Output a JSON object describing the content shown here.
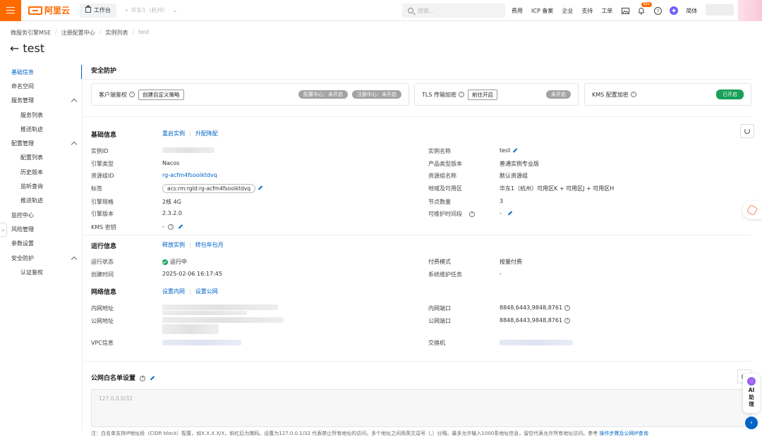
{
  "topbar": {
    "brand": "阿里云",
    "workbench": "工作台",
    "region": "华东1（杭州）",
    "search_placeholder": "搜索...",
    "links": [
      "费用",
      "ICP 备案",
      "企业",
      "支持",
      "工单"
    ],
    "notif_badge": "99+",
    "language": "简体"
  },
  "breadcrumb": [
    "微服务引擎MSE",
    "注册配置中心",
    "实例列表",
    "test"
  ],
  "page_title": "test",
  "sidebar": {
    "items": [
      {
        "label": "基础信息",
        "active": true
      },
      {
        "label": "命名空间"
      },
      {
        "label": "服务管理",
        "expandable": true
      },
      {
        "label": "服务列表",
        "sub": true
      },
      {
        "label": "推送轨迹",
        "sub": true
      },
      {
        "label": "配置管理",
        "expandable": true
      },
      {
        "label": "配置列表",
        "sub": true
      },
      {
        "label": "历史版本",
        "sub": true
      },
      {
        "label": "监听查询",
        "sub": true
      },
      {
        "label": "推送轨迹",
        "sub": true
      },
      {
        "label": "监控中心"
      },
      {
        "label": "风险管理"
      },
      {
        "label": "参数设置"
      },
      {
        "label": "安全防护",
        "expandable": true
      },
      {
        "label": "认证鉴权",
        "sub": true
      }
    ]
  },
  "security": {
    "title": "安全防护",
    "client_auth": "客户端鉴权",
    "create_policy": "创建自定义策略",
    "config_center_status": "配置中心：未开启",
    "registry_center_status": "注册中心：未开启",
    "tls": "TLS 传输加密",
    "tls_goto": "前往开启",
    "tls_status": "未开启",
    "kms": "KMS 配置加密",
    "kms_status": "已开启"
  },
  "basic": {
    "title": "基础信息",
    "restart": "重启实例",
    "upgrade": "升配降配",
    "left": [
      {
        "label": "实例ID",
        "value": ""
      },
      {
        "label": "引擎类型",
        "value": "Nacos"
      },
      {
        "label": "资源组ID",
        "value": "rg-acfm4fsooiktdvq"
      },
      {
        "label": "标签",
        "value": "acs:rm:rgId:rg-acfm4fsooiktdvq"
      },
      {
        "label": "引擎规格",
        "value": "2核 4G"
      },
      {
        "label": "引擎版本",
        "value": "2.3.2.0"
      },
      {
        "label": "KMS 密钥",
        "value": "-"
      }
    ],
    "right": [
      {
        "label": "实例名称",
        "value": "test"
      },
      {
        "label": "产品类型版本",
        "value": "普通实例专业版"
      },
      {
        "label": "资源组名称",
        "value": "默认资源组"
      },
      {
        "label": "地域及可用区",
        "value": "华东1（杭州）可用区K + 可用区J + 可用区H"
      },
      {
        "label": "节点数量",
        "value": "3"
      },
      {
        "label": "可维护时间段",
        "value": "-"
      }
    ]
  },
  "runtime": {
    "title": "运行信息",
    "release": "释放实例",
    "convert": "转包年包月",
    "status_label": "运行状态",
    "status_value": "运行中",
    "created_label": "创建时间",
    "created_value": "2025-02-06 16:17:45",
    "billing_label": "付费模式",
    "billing_value": "按量付费",
    "maint_label": "系统维护任务",
    "maint_value": "-"
  },
  "network": {
    "title": "网络信息",
    "set_private": "设置内网",
    "set_public": "设置公网",
    "private_addr_label": "内网地址",
    "public_addr_label": "公网地址",
    "vpc_label": "VPC信息",
    "private_port_label": "内网端口",
    "private_port_value": "8848,6443,9848,8761",
    "public_port_label": "公网端口",
    "public_port_value": "8848,6443,9848,8761",
    "switch_label": "交换机"
  },
  "whitelist": {
    "title": "公网白名单设置",
    "placeholder": "127.0.0.0/32",
    "note": "注：白名单支持IP地址段（CIDR block）配置，如X.X.X.X/X，斜杠后为掩码。设置为127.0.0.1/32 代表禁止所有地址的访问。多个地址之间用英文逗号（,）分隔。最多允许输入1000条地址信息，留空代表允许所有地址访问。参考",
    "note_link": "操作步骤及公网IP查询"
  },
  "assistant": {
    "line1": "AI",
    "line2": "助",
    "line3": "理"
  },
  "colors": {
    "brand": "#ff6a00",
    "link": "#0064c8",
    "success": "#18a058"
  }
}
